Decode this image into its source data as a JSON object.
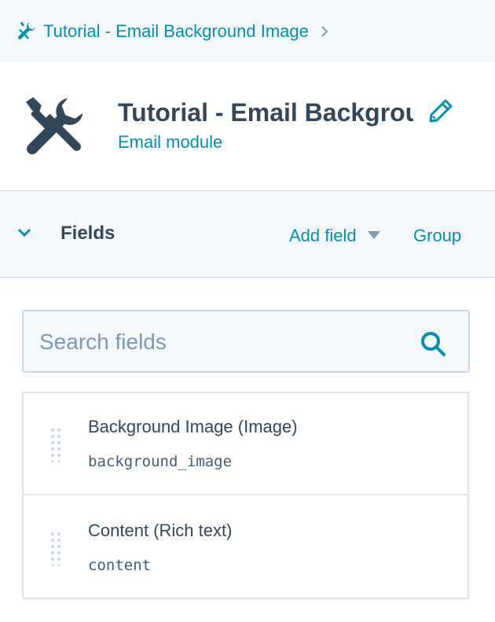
{
  "breadcrumb": {
    "icon": "tools-icon",
    "label": "Tutorial - Email Background Image",
    "chevron": "chevron-right-icon"
  },
  "header": {
    "icon": "tools-icon",
    "title": "Tutorial - Email Background Image",
    "subtitle": "Email module",
    "edit_icon": "pencil-icon"
  },
  "fields_panel": {
    "heading": "Fields",
    "add_field_label": "Add field",
    "group_label": "Group"
  },
  "search": {
    "placeholder": "Search fields",
    "value": ""
  },
  "fields": [
    {
      "label": "Background Image (Image)",
      "name": "background_image"
    },
    {
      "label": "Content (Rich text)",
      "name": "content"
    }
  ],
  "colors": {
    "accent": "#0091ae",
    "text": "#33475b",
    "muted": "#7c98b6",
    "panel_bg": "#f5f8fa",
    "border": "#cbd6e2"
  }
}
